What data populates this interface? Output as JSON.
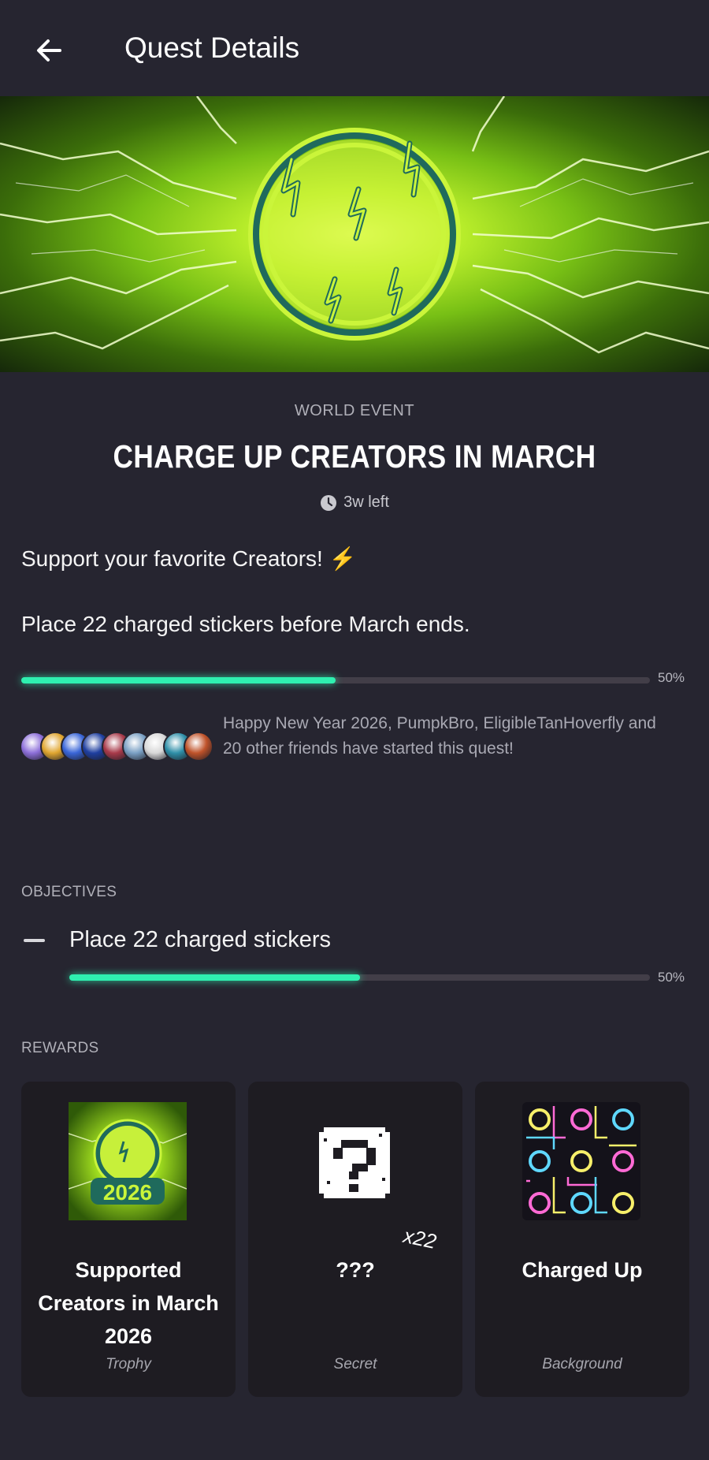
{
  "header": {
    "title": "Quest Details",
    "back_icon": "arrow-left-icon"
  },
  "quest": {
    "category": "WORLD EVENT",
    "title": "CHARGE UP CREATORS IN MARCH",
    "time_left": "3w left",
    "description_line1": "Support your favorite Creators! ⚡",
    "description_line2": "Place 22 charged stickers before March ends.",
    "progress": 0.5,
    "progress_label": "50%"
  },
  "friends": {
    "text": "Happy New Year 2026, PumpkBro, EligibleTanHoverfly and 20 other friends have started this quest!",
    "avatar_colors": [
      "#8d6fd9",
      "#e0a630",
      "#3a66d8",
      "#1f3fa0",
      "#a83a4a",
      "#7aa0c4",
      "#d8d8d8",
      "#2f8fa8",
      "#c0532a"
    ]
  },
  "objectives": {
    "label": "OBJECTIVES",
    "items": [
      {
        "text": "Place 22 charged stickers",
        "progress": 0.5,
        "progress_label": "50%"
      }
    ]
  },
  "rewards": {
    "label": "REWARDS",
    "items": [
      {
        "name": "Supported Creators in March 2026",
        "type": "Trophy",
        "badge_text": "2026"
      },
      {
        "name": "???",
        "type": "Secret",
        "quantity": "x22"
      },
      {
        "name": "Charged Up",
        "type": "Background"
      }
    ]
  },
  "colors": {
    "background": "#262530",
    "card": "#1e1c22",
    "progress_accent": "#2ff0b0",
    "banner_green": "#b7ec2a"
  }
}
